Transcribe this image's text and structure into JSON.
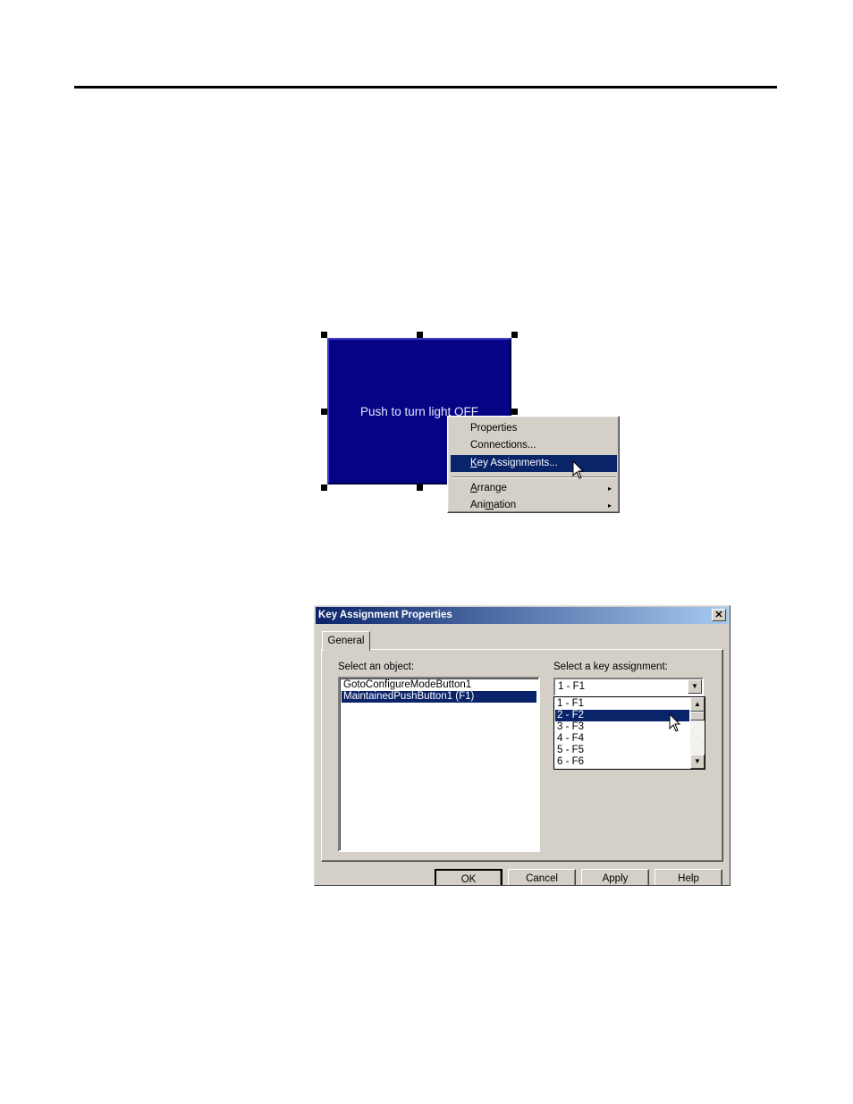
{
  "canvas": {
    "push_button_label": "Push to turn light OFF"
  },
  "context_menu": {
    "items": [
      {
        "label": "Properties"
      },
      {
        "label": "Connections..."
      },
      {
        "label_prefix": "",
        "accel": "K",
        "label_rest": "ey Assignments...",
        "selected": true
      },
      {
        "accel": "A",
        "label_rest": "rrange",
        "submenu": true
      },
      {
        "label_prefix": "Ani",
        "accel": "m",
        "label_rest": "ation",
        "submenu": true
      }
    ],
    "submenu_arrow": "▸"
  },
  "dialog": {
    "title": "Key Assignment Properties",
    "close_glyph": "✕",
    "tab_label": "General",
    "object_label": "Select an object:",
    "objects": [
      "GotoConfigureModeButton1",
      "MaintainedPushButton1 (F1)"
    ],
    "selected_object": 1,
    "key_label": "Select a key assignment:",
    "combo_value": "1 - F1",
    "key_options": [
      "1 - F1",
      "2 - F2",
      "3 - F3",
      "4 - F4",
      "5 - F5",
      "6 - F6"
    ],
    "selected_key": 1,
    "buttons": {
      "ok": "OK",
      "cancel": "Cancel",
      "apply": "Apply",
      "help": "Help"
    }
  },
  "colors": {
    "push_button": "#040485",
    "selection": "#0a246a",
    "dialog_face": "#d4d0c8"
  }
}
